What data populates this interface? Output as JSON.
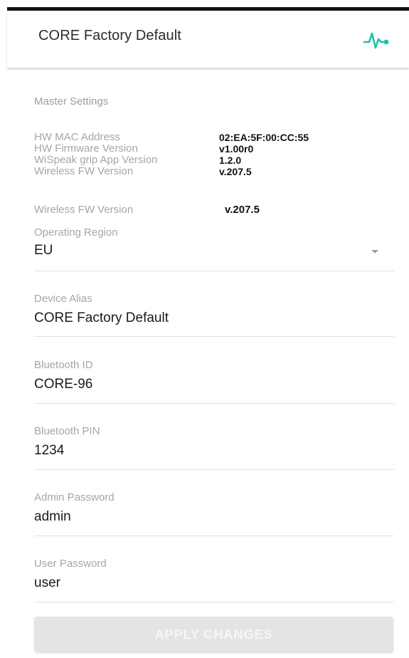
{
  "app_bar": {
    "title": "CORE Factory Default",
    "icon": "pulse-heartbeat-icon",
    "accent_color": "#1fbfa8"
  },
  "master_settings": {
    "section_title": "Master Settings",
    "info": [
      {
        "label": "HW MAC Address",
        "value": "02:EA:5F:00:CC:55"
      },
      {
        "label": "HW Firmware Version",
        "value": "v1.00r0"
      },
      {
        "label": "WiSpeak grip App Version",
        "value": "1.2.0"
      },
      {
        "label": "Wireless FW Version",
        "value": "v.207.5"
      }
    ],
    "extra_info": {
      "label": "Wireless FW Version",
      "value": "v.207.5"
    }
  },
  "fields": {
    "operating_region": {
      "label": "Operating Region",
      "value": "EU"
    },
    "device_alias": {
      "label": "Device Alias",
      "value": "CORE Factory Default"
    },
    "bluetooth_id": {
      "label": "Bluetooth ID",
      "value": "CORE-96"
    },
    "bluetooth_pin": {
      "label": "Bluetooth PIN",
      "value": "1234"
    },
    "admin_password": {
      "label": "Admin Password",
      "value": "admin"
    },
    "user_password": {
      "label": "User Password",
      "value": "user"
    }
  },
  "actions": {
    "apply_label": "APPLY CHANGES"
  }
}
